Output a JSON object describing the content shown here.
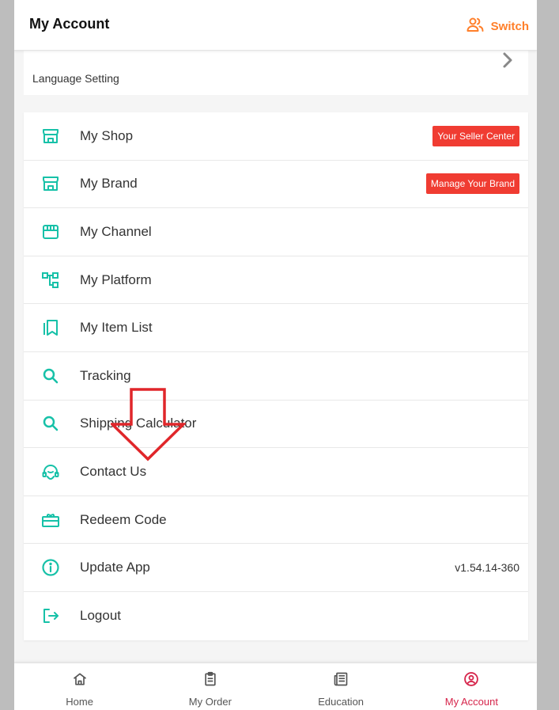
{
  "header": {
    "title": "My Account",
    "switch_label": "Switch"
  },
  "language": {
    "label": "Language Setting"
  },
  "menu": {
    "items": [
      {
        "icon": "shop-icon",
        "label": "My Shop",
        "badge": "Your Seller Center"
      },
      {
        "icon": "brand-icon",
        "label": "My Brand",
        "badge": "Manage Your Brand"
      },
      {
        "icon": "channel-icon",
        "label": "My Channel"
      },
      {
        "icon": "platform-icon",
        "label": "My Platform"
      },
      {
        "icon": "item-list-icon",
        "label": "My Item List"
      },
      {
        "icon": "search-icon",
        "label": "Tracking"
      },
      {
        "icon": "search-icon",
        "label": "Shipping Calculator"
      },
      {
        "icon": "headset-icon",
        "label": "Contact Us"
      },
      {
        "icon": "gift-icon",
        "label": "Redeem Code"
      },
      {
        "icon": "info-icon",
        "label": "Update App",
        "value": "v1.54.14-360"
      },
      {
        "icon": "logout-icon",
        "label": "Logout"
      }
    ]
  },
  "bottom_nav": {
    "items": [
      {
        "icon": "home-icon",
        "label": "Home"
      },
      {
        "icon": "clipboard-icon",
        "label": "My Order"
      },
      {
        "icon": "newspaper-icon",
        "label": "Education"
      },
      {
        "icon": "account-icon",
        "label": "My Account",
        "active": true
      }
    ]
  },
  "colors": {
    "accent": "#17c1a8",
    "switch": "#ff7f2a",
    "badge": "#f03c32",
    "active_nav": "#d6254b",
    "arrow": "#e0262a"
  }
}
